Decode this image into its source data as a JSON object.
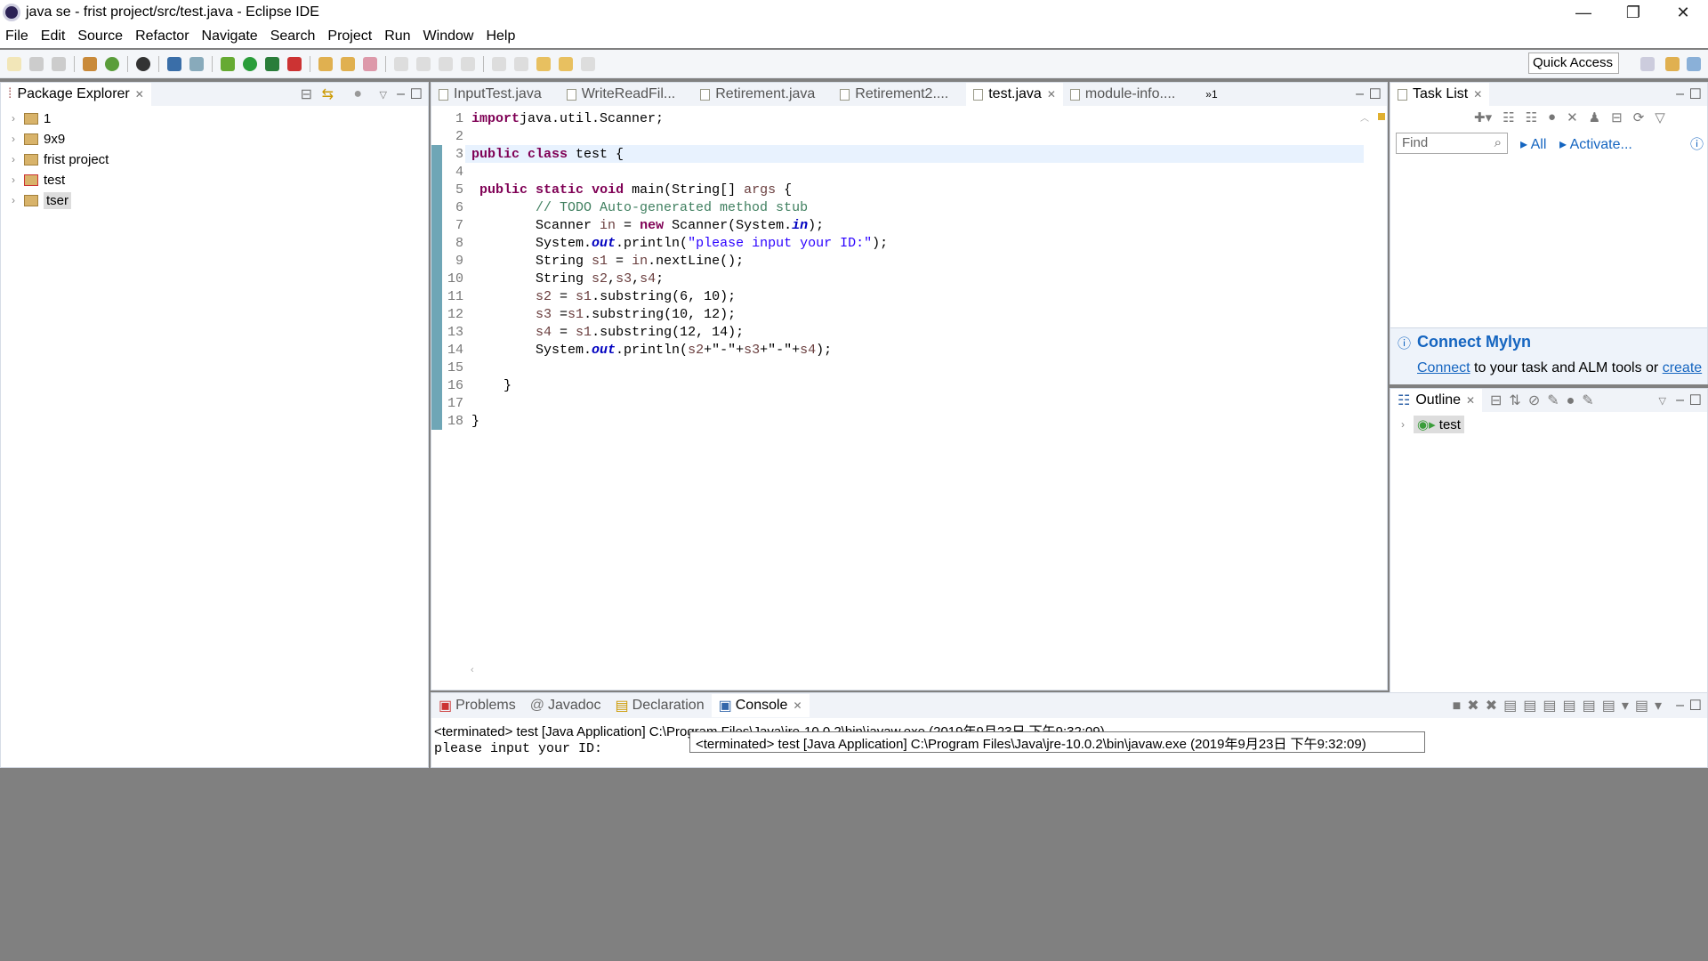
{
  "window": {
    "title": "java se - frist project/src/test.java - Eclipse IDE"
  },
  "menu": [
    "File",
    "Edit",
    "Source",
    "Refactor",
    "Navigate",
    "Search",
    "Project",
    "Run",
    "Window",
    "Help"
  ],
  "toolbar": {
    "quick_access": "Quick Access"
  },
  "package_explorer": {
    "title": "Package Explorer",
    "items": [
      "1",
      "9x9",
      "frist project",
      "test",
      "tser"
    ],
    "selected": "tser"
  },
  "editor": {
    "tabs": [
      "InputTest.java",
      "WriteReadFil...",
      "Retirement.java",
      "Retirement2....",
      "test.java",
      "module-info...."
    ],
    "active_tab": "test.java",
    "overflow": "»1",
    "lines": [
      [
        [
          "kw",
          "import"
        ],
        [
          "",
          "java.util.Scanner;"
        ]
      ],
      [],
      [
        [
          "kw",
          "public"
        ],
        [
          "",
          " "
        ],
        [
          "kw",
          "class"
        ],
        [
          "",
          " test {"
        ]
      ],
      [],
      [
        [
          "",
          " "
        ],
        [
          "kw",
          "public"
        ],
        [
          "",
          " "
        ],
        [
          "kw",
          "static"
        ],
        [
          "",
          " "
        ],
        [
          "kw",
          "void"
        ],
        [
          "",
          " main(String[] "
        ],
        [
          "lv",
          "args"
        ],
        [
          "",
          " {"
        ]
      ],
      [
        [
          "",
          "        "
        ],
        [
          "cm",
          "// TODO Auto-generated method stub"
        ]
      ],
      [
        [
          "",
          "        Scanner "
        ],
        [
          "lv",
          "in"
        ],
        [
          "",
          " = "
        ],
        [
          "kw",
          "new"
        ],
        [
          "",
          " Scanner(System."
        ],
        [
          "fd",
          "in"
        ],
        [
          "",
          ");"
        ]
      ],
      [
        [
          "",
          "        System."
        ],
        [
          "fd",
          "out"
        ],
        [
          "",
          ".println("
        ],
        [
          "st",
          "\"please input your ID:\""
        ],
        [
          "",
          ");"
        ]
      ],
      [
        [
          "",
          "        String "
        ],
        [
          "lv",
          "s1"
        ],
        [
          "",
          " = "
        ],
        [
          "lv",
          "in"
        ],
        [
          "",
          ".nextLine();"
        ]
      ],
      [
        [
          "",
          "        String "
        ],
        [
          "lv",
          "s2"
        ],
        [
          "",
          ","
        ],
        [
          "lv",
          "s3"
        ],
        [
          "",
          ","
        ],
        [
          "lv",
          "s4"
        ],
        [
          "",
          ";"
        ]
      ],
      [
        [
          "",
          "        "
        ],
        [
          "lv",
          "s2"
        ],
        [
          "",
          " = "
        ],
        [
          "lv",
          "s1"
        ],
        [
          "",
          ".substring(6, 10);"
        ]
      ],
      [
        [
          "",
          "        "
        ],
        [
          "lv",
          "s3"
        ],
        [
          "",
          " ="
        ],
        [
          "lv",
          "s1"
        ],
        [
          "",
          ".substring(10, 12);"
        ]
      ],
      [
        [
          "",
          "        "
        ],
        [
          "lv",
          "s4"
        ],
        [
          "",
          " = "
        ],
        [
          "lv",
          "s1"
        ],
        [
          "",
          ".substring(12, 14);"
        ]
      ],
      [
        [
          "",
          "        System."
        ],
        [
          "fd",
          "out"
        ],
        [
          "",
          ".println("
        ],
        [
          "lv",
          "s2"
        ],
        [
          "",
          "+\"-\"+"
        ],
        [
          "lv",
          "s3"
        ],
        [
          "",
          "+\"-\"+"
        ],
        [
          "lv",
          "s4"
        ],
        [
          "",
          ");"
        ]
      ],
      [],
      [
        [
          "",
          "    }"
        ]
      ],
      [],
      [
        [
          "",
          "}"
        ]
      ]
    ]
  },
  "task_list": {
    "title": "Task List",
    "find_placeholder": "Find",
    "all": "All",
    "activate": "Activate...",
    "mylyn_title": "Connect Mylyn",
    "mylyn_connect": "Connect",
    "mylyn_text": " to your task and ALM tools or ",
    "mylyn_create": "create"
  },
  "outline": {
    "title": "Outline",
    "items": [
      "test"
    ]
  },
  "console": {
    "tabs": [
      "Problems",
      "Javadoc",
      "Declaration",
      "Console"
    ],
    "active_tab": "Console",
    "header": "<terminated> test [Java Application] C:\\Program Files\\Java\\jre-10.0.2\\bin\\javaw.exe (2019年9月23日 下午9:32:09)",
    "output": "please input your ID:",
    "tooltip": "<terminated> test [Java Application] C:\\Program Files\\Java\\jre-10.0.2\\bin\\javaw.exe (2019年9月23日 下午9:32:09)"
  }
}
